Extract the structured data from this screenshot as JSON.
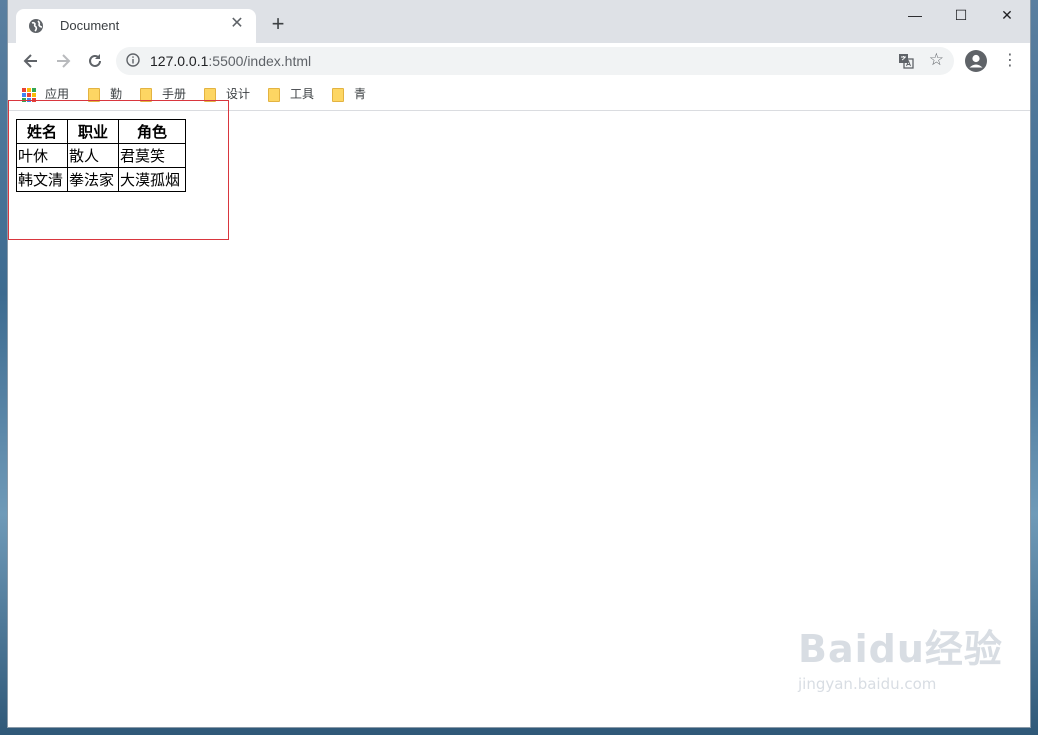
{
  "browser": {
    "tab_title": "Document",
    "close_tab": "✕",
    "new_tab": "+",
    "window_controls": {
      "minimize": "—",
      "maximize": "☐",
      "close": "✕"
    },
    "url_host": "127.0.0.1",
    "url_rest": ":5500/index.html",
    "bookmarks": [
      {
        "label": "应用",
        "icon": "apps-grid-icon"
      },
      {
        "label": "勤",
        "icon": "folder-icon"
      },
      {
        "label": "手册",
        "icon": "folder-icon"
      },
      {
        "label": "设计",
        "icon": "folder-icon"
      },
      {
        "label": "工具",
        "icon": "folder-icon"
      },
      {
        "label": "青",
        "icon": "folder-icon"
      }
    ]
  },
  "table": {
    "headers": [
      "姓名",
      "职业",
      "角色"
    ],
    "rows": [
      [
        "叶休",
        "散人",
        "君莫笑"
      ],
      [
        "韩文清",
        "拳法家",
        "大漠孤烟"
      ]
    ]
  },
  "watermark": {
    "brand": "Baidu经验",
    "domain": "jingyan.baidu.com"
  },
  "colors": {
    "highlight_border": "#d9363e",
    "tab_strip": "#dee1e6",
    "omnibox": "#f1f3f4"
  }
}
